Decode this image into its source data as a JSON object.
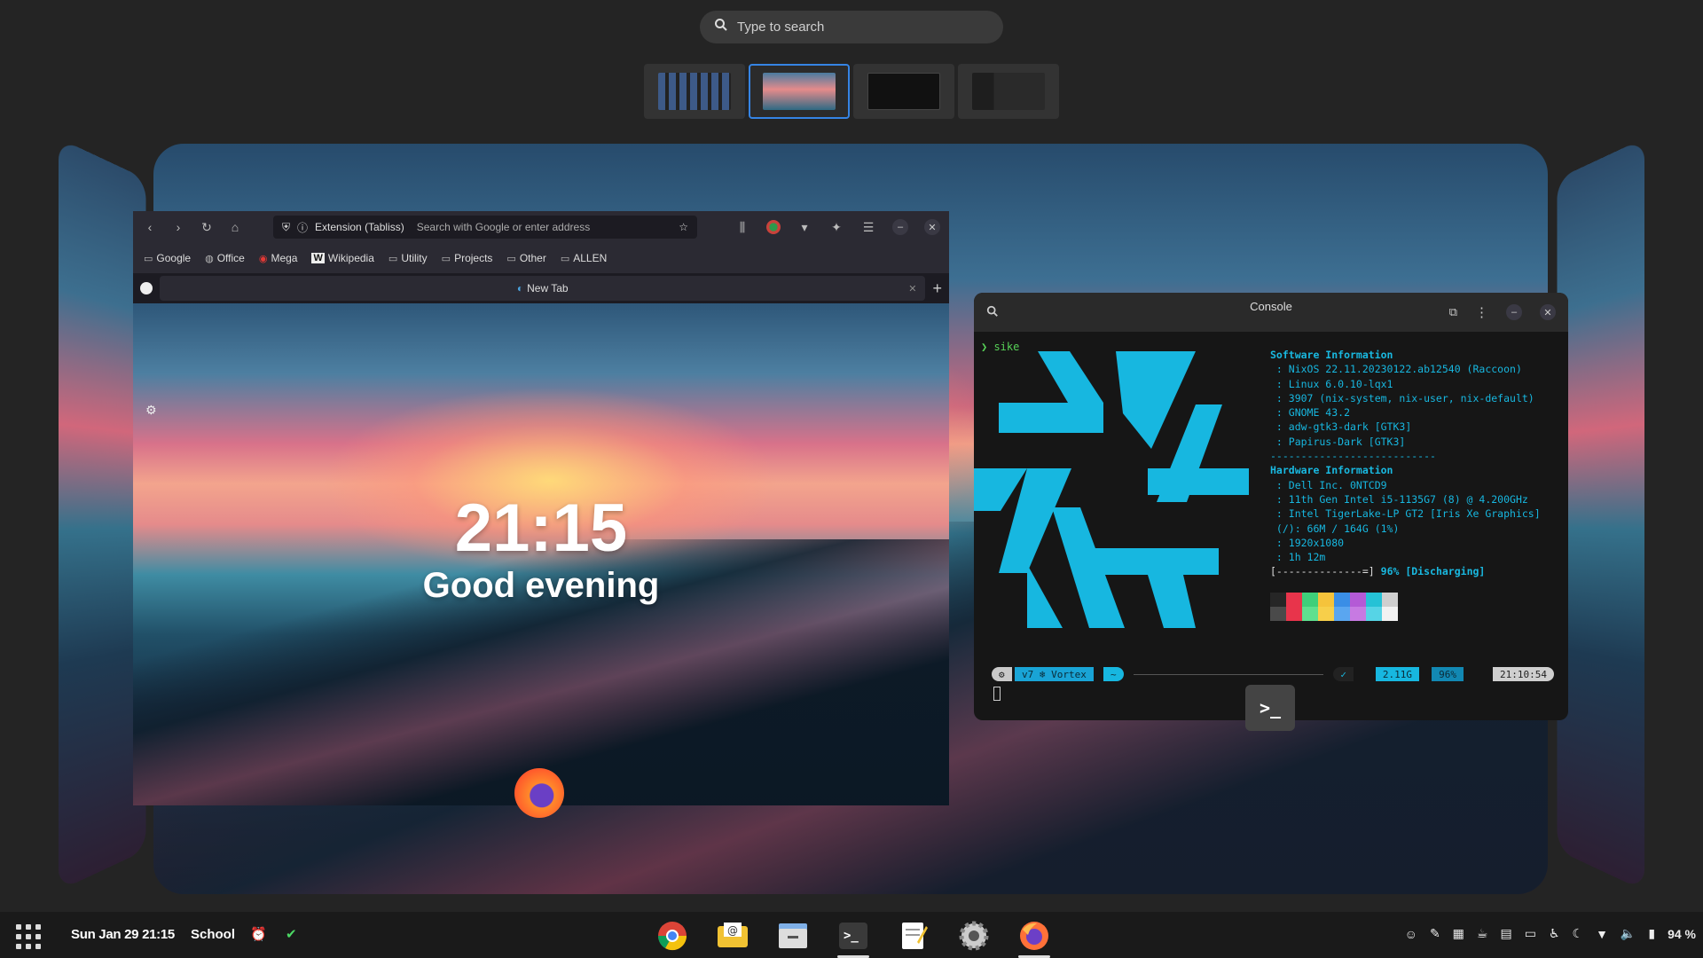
{
  "search": {
    "placeholder": "Type to search"
  },
  "workspaces": {
    "count": 4,
    "active_index": 1
  },
  "firefox": {
    "url_extension_label": "Extension (Tabliss)",
    "url_placeholder": "Search with Google or enter address",
    "bookmarks": [
      "Google",
      "Office",
      "Mega",
      "Wikipedia",
      "Utility",
      "Projects",
      "Other",
      "ALLEN"
    ],
    "tab_label": "New Tab",
    "clock": "21:15",
    "greeting": "Good evening"
  },
  "console": {
    "title": "Console",
    "prompt": "❯ sike",
    "software_header": "Software Information",
    "software_lines": [
      " : NixOS 22.11.20230122.ab12540 (Raccoon)",
      " : Linux 6.0.10-lqx1",
      " : 3907 (nix-system, nix-user, nix-default)",
      " : GNOME 43.2",
      " : adw-gtk3-dark [GTK3]",
      " : Papirus-Dark [GTK3]"
    ],
    "separator": "---------------------------",
    "hardware_header": "Hardware Information",
    "hardware_lines": [
      " : Dell Inc. 0NTCD9",
      " : 11th Gen Intel i5-1135G7 (8) @ 4.200GHz",
      " : Intel TigerLake-LP GT2 [Iris Xe Graphics]",
      " (/): 66M / 164G (1%)",
      " : 1920x1080",
      " : 1h 12m"
    ],
    "battery_bar": "[--------------=]",
    "battery_text": "96% [Discharging]",
    "status_left": "v7 ❄ Vortex",
    "status_tilde": "~",
    "status_mem": "2.11G",
    "status_batt": "96%",
    "status_time": "21:10:54",
    "palette": [
      "#262626",
      "#e8344b",
      "#3fcf7a",
      "#f5c33b",
      "#3a8ee6",
      "#b45ad6",
      "#25c2d6",
      "#cfcfcf",
      "#4a4a4a",
      "#e8344b",
      "#5fe08f",
      "#f7cf4a",
      "#5aa6f0",
      "#c77ae2",
      "#56d4e6",
      "#f2f2f2"
    ]
  },
  "panel": {
    "datetime": "Sun Jan 29  21:15",
    "workspace_label": "School",
    "battery": "94 %",
    "dock_apps": [
      "chrome-icon",
      "mail-icon",
      "files-icon",
      "terminal-icon",
      "text-editor-icon",
      "settings-icon",
      "firefox-icon"
    ]
  }
}
